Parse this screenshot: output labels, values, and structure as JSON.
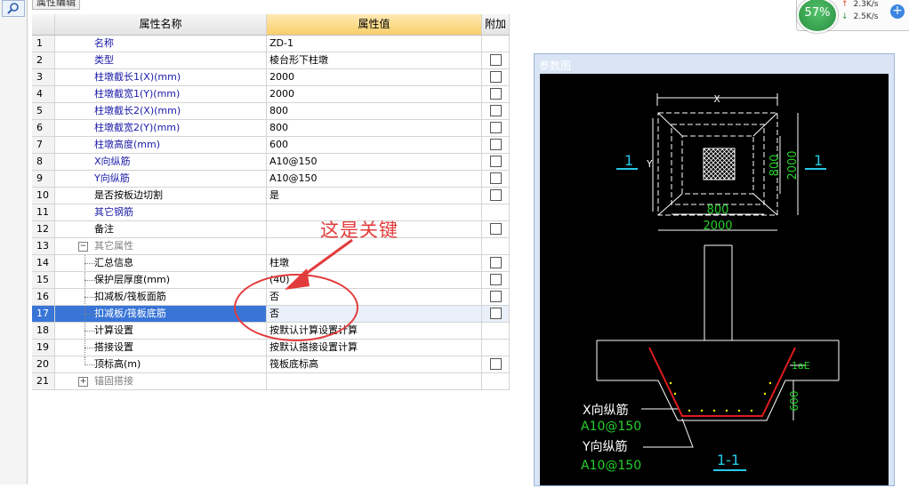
{
  "panel": {
    "tab_title": "属性编辑"
  },
  "table": {
    "headers": {
      "name": "属性名称",
      "value": "属性值",
      "add": "附加"
    },
    "rows": [
      {
        "num": "1",
        "name": "名称",
        "value": "ZD-1",
        "color": "blue",
        "checkbox": false
      },
      {
        "num": "2",
        "name": "类型",
        "value": "棱台形下柱墩",
        "color": "blue",
        "checkbox": true
      },
      {
        "num": "3",
        "name": "柱墩截长1(X)(mm)",
        "value": "2000",
        "color": "blue",
        "checkbox": true
      },
      {
        "num": "4",
        "name": "柱墩截宽1(Y)(mm)",
        "value": "2000",
        "color": "blue",
        "checkbox": true
      },
      {
        "num": "5",
        "name": "柱墩截长2(X)(mm)",
        "value": "800",
        "color": "blue",
        "checkbox": true
      },
      {
        "num": "6",
        "name": "柱墩截宽2(Y)(mm)",
        "value": "800",
        "color": "blue",
        "checkbox": true
      },
      {
        "num": "7",
        "name": "柱墩高度(mm)",
        "value": "600",
        "color": "blue",
        "checkbox": true
      },
      {
        "num": "8",
        "name": "X向纵筋",
        "value": "A10@150",
        "color": "blue",
        "checkbox": true
      },
      {
        "num": "9",
        "name": "Y向纵筋",
        "value": "A10@150",
        "color": "blue",
        "checkbox": true
      },
      {
        "num": "10",
        "name": "是否按板边切割",
        "value": "是",
        "color": "black",
        "checkbox": true
      },
      {
        "num": "11",
        "name": "其它钢筋",
        "value": "",
        "color": "blue",
        "checkbox": false
      },
      {
        "num": "12",
        "name": "备注",
        "value": "",
        "color": "black",
        "checkbox": true
      },
      {
        "num": "13",
        "name": "其它属性",
        "value": "",
        "color": "gray",
        "checkbox": false,
        "expander": "−"
      },
      {
        "num": "14",
        "name": "汇总信息",
        "value": "柱墩",
        "color": "black",
        "checkbox": true,
        "tree": true
      },
      {
        "num": "15",
        "name": "保护层厚度(mm)",
        "value": "(40)",
        "color": "black",
        "checkbox": true,
        "tree": true
      },
      {
        "num": "16",
        "name": "扣减板/筏板面筋",
        "value": "否",
        "color": "black",
        "checkbox": true,
        "tree": true
      },
      {
        "num": "17",
        "name": "扣减板/筏板底筋",
        "value": "否",
        "color": "black",
        "checkbox": true,
        "tree": true,
        "selected": true
      },
      {
        "num": "18",
        "name": "计算设置",
        "value": "按默认计算设置计算",
        "color": "black",
        "checkbox": false,
        "tree": true
      },
      {
        "num": "19",
        "name": "搭接设置",
        "value": "按默认搭接设置计算",
        "color": "black",
        "checkbox": false,
        "tree": true
      },
      {
        "num": "20",
        "name": "顶标高(m)",
        "value": "筏板底标高",
        "color": "black",
        "checkbox": true,
        "tree": true,
        "tree_last": true
      },
      {
        "num": "21",
        "name": "锚固搭接",
        "value": "",
        "color": "gray",
        "checkbox": false,
        "expander": "+"
      }
    ]
  },
  "annotation": {
    "text": "这是关键"
  },
  "param_window": {
    "title": "参数图",
    "plan": {
      "x_label": "X",
      "y_label": "Y",
      "inner_x": "800",
      "outer_x": "2000",
      "inner_y": "800",
      "outer_y": "2000",
      "section_mark": "1"
    },
    "section": {
      "lae_label": "1aE",
      "height_label": "600",
      "x_rebar_label": "X向纵筋",
      "x_rebar_value": "A10@150",
      "y_rebar_label": "Y向纵筋",
      "y_rebar_value": "A10@150",
      "title": "1-1"
    }
  },
  "net_widget": {
    "percent": "57%",
    "upload": "2.3K/s",
    "download": "2.5K/s"
  },
  "colors": {
    "selection": "#3875d7",
    "value_header": "#f8cf6a",
    "annotation": "#e23b3b",
    "cad_green": "#23d12a",
    "cad_cyan": "#28c8e8",
    "rebar_red": "#e01b1b"
  }
}
